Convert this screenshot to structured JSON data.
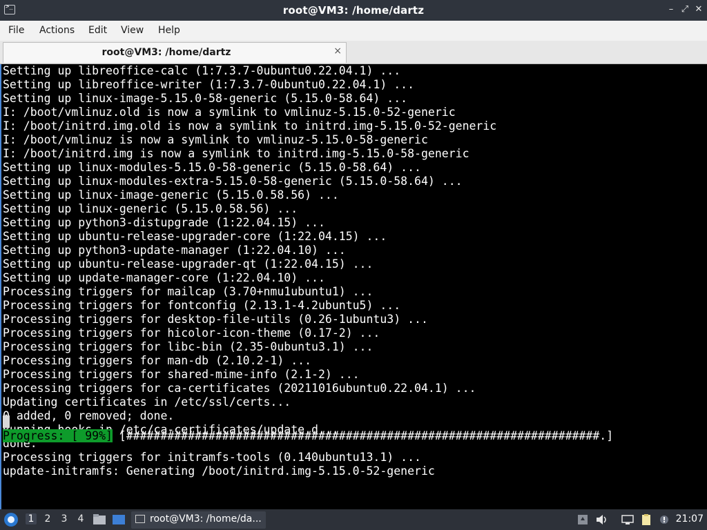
{
  "window": {
    "title": "root@VM3: /home/dartz"
  },
  "menubar": {
    "items": [
      "File",
      "Actions",
      "Edit",
      "View",
      "Help"
    ]
  },
  "tab": {
    "label": "root@VM3: /home/dartz",
    "close_glyph": "×"
  },
  "terminal": {
    "lines": [
      "Setting up libreoffice-calc (1:7.3.7-0ubuntu0.22.04.1) ...",
      "Setting up libreoffice-writer (1:7.3.7-0ubuntu0.22.04.1) ...",
      "Setting up linux-image-5.15.0-58-generic (5.15.0-58.64) ...",
      "I: /boot/vmlinuz.old is now a symlink to vmlinuz-5.15.0-52-generic",
      "I: /boot/initrd.img.old is now a symlink to initrd.img-5.15.0-52-generic",
      "I: /boot/vmlinuz is now a symlink to vmlinuz-5.15.0-58-generic",
      "I: /boot/initrd.img is now a symlink to initrd.img-5.15.0-58-generic",
      "Setting up linux-modules-5.15.0-58-generic (5.15.0-58.64) ...",
      "Setting up linux-modules-extra-5.15.0-58-generic (5.15.0-58.64) ...",
      "Setting up linux-image-generic (5.15.0.58.56) ...",
      "Setting up linux-generic (5.15.0.58.56) ...",
      "Setting up python3-distupgrade (1:22.04.15) ...",
      "Setting up ubuntu-release-upgrader-core (1:22.04.15) ...",
      "Setting up python3-update-manager (1:22.04.10) ...",
      "Setting up ubuntu-release-upgrader-qt (1:22.04.15) ...",
      "Setting up update-manager-core (1:22.04.10) ...",
      "Processing triggers for mailcap (3.70+nmu1ubuntu1) ...",
      "Processing triggers for fontconfig (2.13.1-4.2ubuntu5) ...",
      "Processing triggers for desktop-file-utils (0.26-1ubuntu3) ...",
      "Processing triggers for hicolor-icon-theme (0.17-2) ...",
      "Processing triggers for libc-bin (2.35-0ubuntu3.1) ...",
      "Processing triggers for man-db (2.10.2-1) ...",
      "Processing triggers for shared-mime-info (2.1-2) ...",
      "Processing triggers for ca-certificates (20211016ubuntu0.22.04.1) ...",
      "Updating certificates in /etc/ssl/certs...",
      "0 added, 0 removed; done.",
      "Running hooks in /etc/ca-certificates/update.d...",
      "done.",
      "Processing triggers for initramfs-tools (0.140ubuntu13.1) ...",
      "update-initramfs: Generating /boot/initrd.img-5.15.0-52-generic"
    ],
    "progress": {
      "label": "Progress: [ 99%]",
      "bar": "[#####################################################################.]",
      "percent": 99
    }
  },
  "taskbar": {
    "workspaces": [
      "1",
      "2",
      "3",
      "4"
    ],
    "active_workspace": "1",
    "task_label": "root@VM3: /home/da...",
    "clock": "21:07"
  },
  "colors": {
    "terminal_bg": "#000000",
    "terminal_fg": "#ffffff",
    "progress_bg": "#0e9b2b",
    "accent": "#4a88d8"
  }
}
